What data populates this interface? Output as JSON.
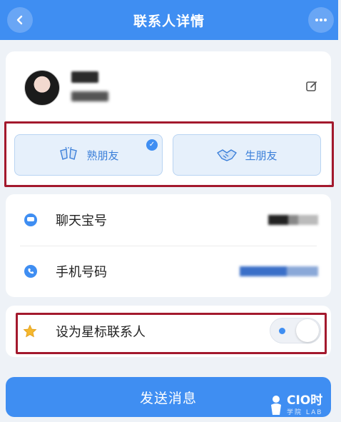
{
  "header": {
    "title": "联系人详情",
    "back_icon": "chevron-left-icon",
    "more_icon": "ellipsis-icon"
  },
  "profile": {
    "edit_icon": "pencil-icon"
  },
  "friend_tags": [
    {
      "label": "熟朋友",
      "icon": "toast-cheers-icon",
      "selected": true
    },
    {
      "label": "生朋友",
      "icon": "handshake-icon",
      "selected": false
    }
  ],
  "info_rows": [
    {
      "label": "聊天宝号",
      "icon": "chat-bubble-icon"
    },
    {
      "label": "手机号码",
      "icon": "phone-icon"
    }
  ],
  "star_contact": {
    "label": "设为星标联系人",
    "icon": "star-icon",
    "enabled": false
  },
  "send_button": {
    "label": "发送消息"
  },
  "watermark": {
    "text": "CIO时",
    "sub": "学院 LAB"
  },
  "colors": {
    "accent": "#3f8ef2",
    "highlight_box": "#a3192d"
  }
}
